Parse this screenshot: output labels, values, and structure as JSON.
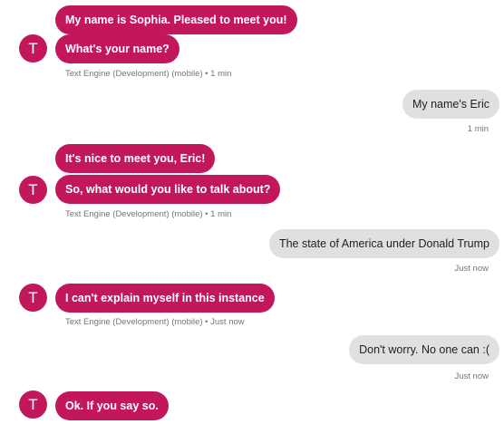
{
  "avatar_letter": "T",
  "colors": {
    "bot_bubble": "#c2185b",
    "user_bubble": "#e0e0e0",
    "meta_text": "#757575"
  },
  "messages": [
    {
      "sender": "bot",
      "text": "My name is Sophia. Pleased to meet you!"
    },
    {
      "sender": "bot",
      "text": "What's your name?"
    },
    {
      "sender": "bot_meta",
      "text": "Text Engine (Development) (mobile) • 1 min"
    },
    {
      "sender": "user",
      "text": "My name's Eric"
    },
    {
      "sender": "user_meta",
      "text": "1 min"
    },
    {
      "sender": "bot",
      "text": "It's nice to meet you,  Eric!"
    },
    {
      "sender": "bot",
      "text": "So, what would you like to talk about?"
    },
    {
      "sender": "bot_meta",
      "text": "Text Engine (Development) (mobile) • 1 min"
    },
    {
      "sender": "user",
      "text": "The state of America under Donald Trump"
    },
    {
      "sender": "user_meta",
      "text": "Just now"
    },
    {
      "sender": "bot",
      "text": "I can't explain myself in this instance"
    },
    {
      "sender": "bot_meta",
      "text": "Text Engine (Development) (mobile) • Just now"
    },
    {
      "sender": "user",
      "text": "Don't worry. No one can :("
    },
    {
      "sender": "user_meta",
      "text": "Just now"
    },
    {
      "sender": "bot",
      "text": "Ok. If you say so."
    }
  ]
}
